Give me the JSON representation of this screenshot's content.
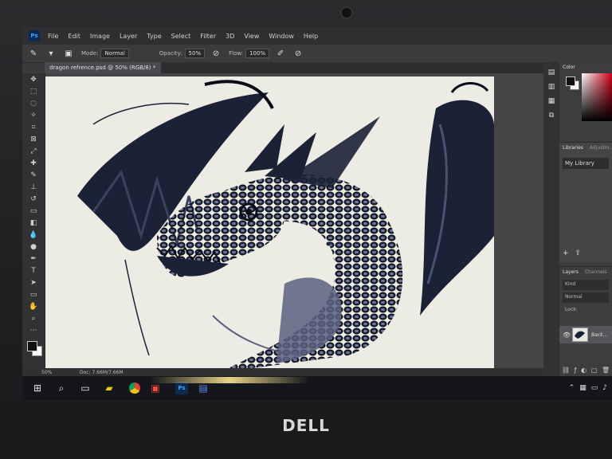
{
  "app": {
    "name": "Photoshop",
    "logo_text": "Ps"
  },
  "menu": [
    "File",
    "Edit",
    "Image",
    "Layer",
    "Type",
    "Select",
    "Filter",
    "3D",
    "View",
    "Window",
    "Help"
  ],
  "options_bar": {
    "mode_label": "Mode:",
    "mode_value": "Normal",
    "opacity_label": "Opacity:",
    "opacity_value": "50%",
    "flow_label": "Flow:",
    "flow_value": "100%"
  },
  "document": {
    "tab_title": "dragon refrence.psd @ 50% (RGB/8) *"
  },
  "status": {
    "zoom": "50%",
    "doc_size": "Doc: 7.66M/7.66M"
  },
  "panels": {
    "color_tab": "Color",
    "libraries_tab": "Libraries",
    "adjustments_tab": "Adjustm...",
    "library_name": "My Library",
    "layers_tab": "Layers",
    "channels_tab": "Channels",
    "kind_placeholder": "Kind",
    "blend_mode": "Normal",
    "lock_label": "Lock:",
    "layer_name": "Back..."
  },
  "brand": "DELL",
  "colors": {
    "foreground": "#111111",
    "background": "#f4f4f4",
    "accent": "#31a8ff"
  },
  "icons": [
    "brush-icon",
    "move-icon",
    "marquee-icon",
    "lasso-icon",
    "crop-icon",
    "eyedropper-icon",
    "eye-icon",
    "windows-start-icon",
    "chrome-icon"
  ]
}
